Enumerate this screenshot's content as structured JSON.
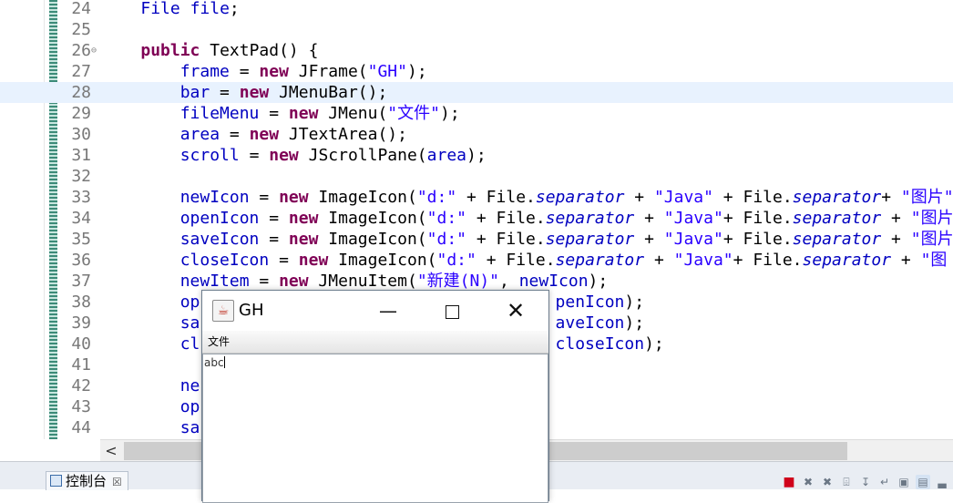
{
  "editor": {
    "lines": [
      {
        "n": "24",
        "html": "    <span class=\"fld\">File</span> <span class=\"fld\">file</span>;"
      },
      {
        "n": "25",
        "html": ""
      },
      {
        "n": "26",
        "fold": "⊖",
        "html": "    <span class=\"kw\">public</span> TextPad() {"
      },
      {
        "n": "27",
        "html": "        <span class=\"fld\">frame</span> = <span class=\"kw\">new</span> JFrame(<span class=\"str\">\"GH\"</span>);"
      },
      {
        "n": "28",
        "current": true,
        "html": "        <span class=\"fld\">bar</span> = <span class=\"kw\">new</span> JMenuBar();"
      },
      {
        "n": "29",
        "html": "        <span class=\"fld\">fileMenu</span> = <span class=\"kw\">new</span> JMenu(<span class=\"str\">\"文件\"</span>);"
      },
      {
        "n": "30",
        "html": "        <span class=\"fld\">area</span> = <span class=\"kw\">new</span> JTextArea();"
      },
      {
        "n": "31",
        "html": "        <span class=\"fld\">scroll</span> = <span class=\"kw\">new</span> JScrollPane(<span class=\"fld\">area</span>);"
      },
      {
        "n": "32",
        "html": ""
      },
      {
        "n": "33",
        "html": "        <span class=\"fld\">newIcon</span> = <span class=\"kw\">new</span> ImageIcon(<span class=\"str\">\"d:\"</span> + File.<span class=\"sfld\">separator</span> + <span class=\"str\">\"Java\"</span> + File.<span class=\"sfld\">separator</span>+ <span class=\"str\">\"图片\"</span>"
      },
      {
        "n": "34",
        "html": "        <span class=\"fld\">openIcon</span> = <span class=\"kw\">new</span> ImageIcon(<span class=\"str\">\"d:\"</span> + File.<span class=\"sfld\">separator</span> + <span class=\"str\">\"Java\"</span>+ File.<span class=\"sfld\">separator</span> + <span class=\"str\">\"图片</span>"
      },
      {
        "n": "35",
        "html": "        <span class=\"fld\">saveIcon</span> = <span class=\"kw\">new</span> ImageIcon(<span class=\"str\">\"d:\"</span> + File.<span class=\"sfld\">separator</span> + <span class=\"str\">\"Java\"</span>+ File.<span class=\"sfld\">separator</span> + <span class=\"str\">\"图片</span>"
      },
      {
        "n": "36",
        "html": "        <span class=\"fld\">closeIcon</span> = <span class=\"kw\">new</span> ImageIcon(<span class=\"str\">\"d:\"</span> + File.<span class=\"sfld\">separator</span> + <span class=\"str\">\"Java\"</span>+ File.<span class=\"sfld\">separator</span> + <span class=\"str\">\"图</span>"
      },
      {
        "n": "37",
        "html": "        <span class=\"fld\">newItem</span> = <span class=\"kw\">new</span> JMenuItem(<span class=\"str\">\"新建(N)\"</span>, <span class=\"fld\">newIcon</span>);"
      },
      {
        "n": "38",
        "html": "        <span class=\"fld\">op</span>                                    <span class=\"fld\">penIcon</span>);"
      },
      {
        "n": "39",
        "html": "        <span class=\"fld\">sa</span>                                    <span class=\"fld\">aveIcon</span>);"
      },
      {
        "n": "40",
        "html": "        <span class=\"fld\">cl</span>                                    <span class=\"fld\">closeIcon</span>);"
      },
      {
        "n": "41",
        "html": ""
      },
      {
        "n": "42",
        "html": "        <span class=\"fld\">ne</span>"
      },
      {
        "n": "43",
        "html": "        <span class=\"fld\">op</span>"
      },
      {
        "n": "44",
        "html": "        <span class=\"fld\">sa</span>"
      }
    ]
  },
  "hscroll": {
    "left_arrow": "<"
  },
  "console": {
    "label": "控制台",
    "close": "☒"
  },
  "toolbar": {
    "icons": [
      "stop-icon",
      "remove-launch-icon",
      "remove-all-icon",
      "clear-console-icon",
      "scroll-lock-icon",
      "word-wrap-icon",
      "pin-console-icon",
      "open-console-icon",
      "minimize-icon"
    ],
    "glyphs": [
      "■",
      "✖",
      "✖",
      "⌹",
      "↧",
      "↵",
      "▣",
      "▤",
      "▃"
    ]
  },
  "window": {
    "title": "GH",
    "java_icon": "☕",
    "minimize": "—",
    "close": "✕",
    "menu": "文件",
    "text": "abc"
  }
}
